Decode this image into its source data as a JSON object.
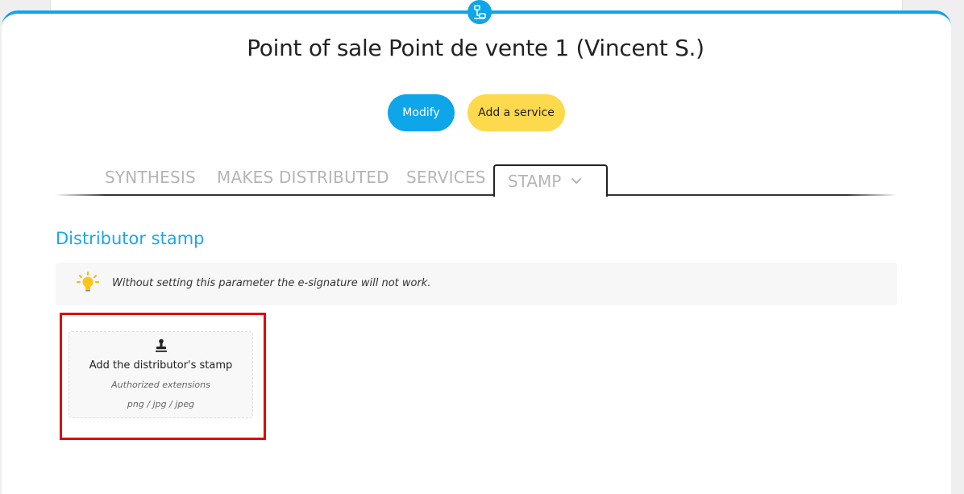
{
  "header": {
    "title": "Point of sale Point de vente 1 (Vincent S.)",
    "icon": "network-icon"
  },
  "actions": {
    "modify_label": "Modify",
    "add_service_label": "Add a service"
  },
  "tabs": [
    {
      "label": "SYNTHESIS",
      "active": false
    },
    {
      "label": "MAKES DISTRIBUTED",
      "active": false
    },
    {
      "label": "SERVICES",
      "active": false
    },
    {
      "label": "STAMP",
      "active": true
    }
  ],
  "section": {
    "title": "Distributor stamp",
    "info_text": "Without setting this parameter the e-signature will not work.",
    "info_icon": "lightbulb-icon"
  },
  "upload": {
    "icon": "stamp-icon",
    "title": "Add the distributor's stamp",
    "subtitle": "Authorized extensions",
    "extensions": "png / jpg / jpeg"
  },
  "colors": {
    "accent": "#0ea5e9",
    "secondary_button": "#fcd94d",
    "highlight": "#e00000"
  }
}
